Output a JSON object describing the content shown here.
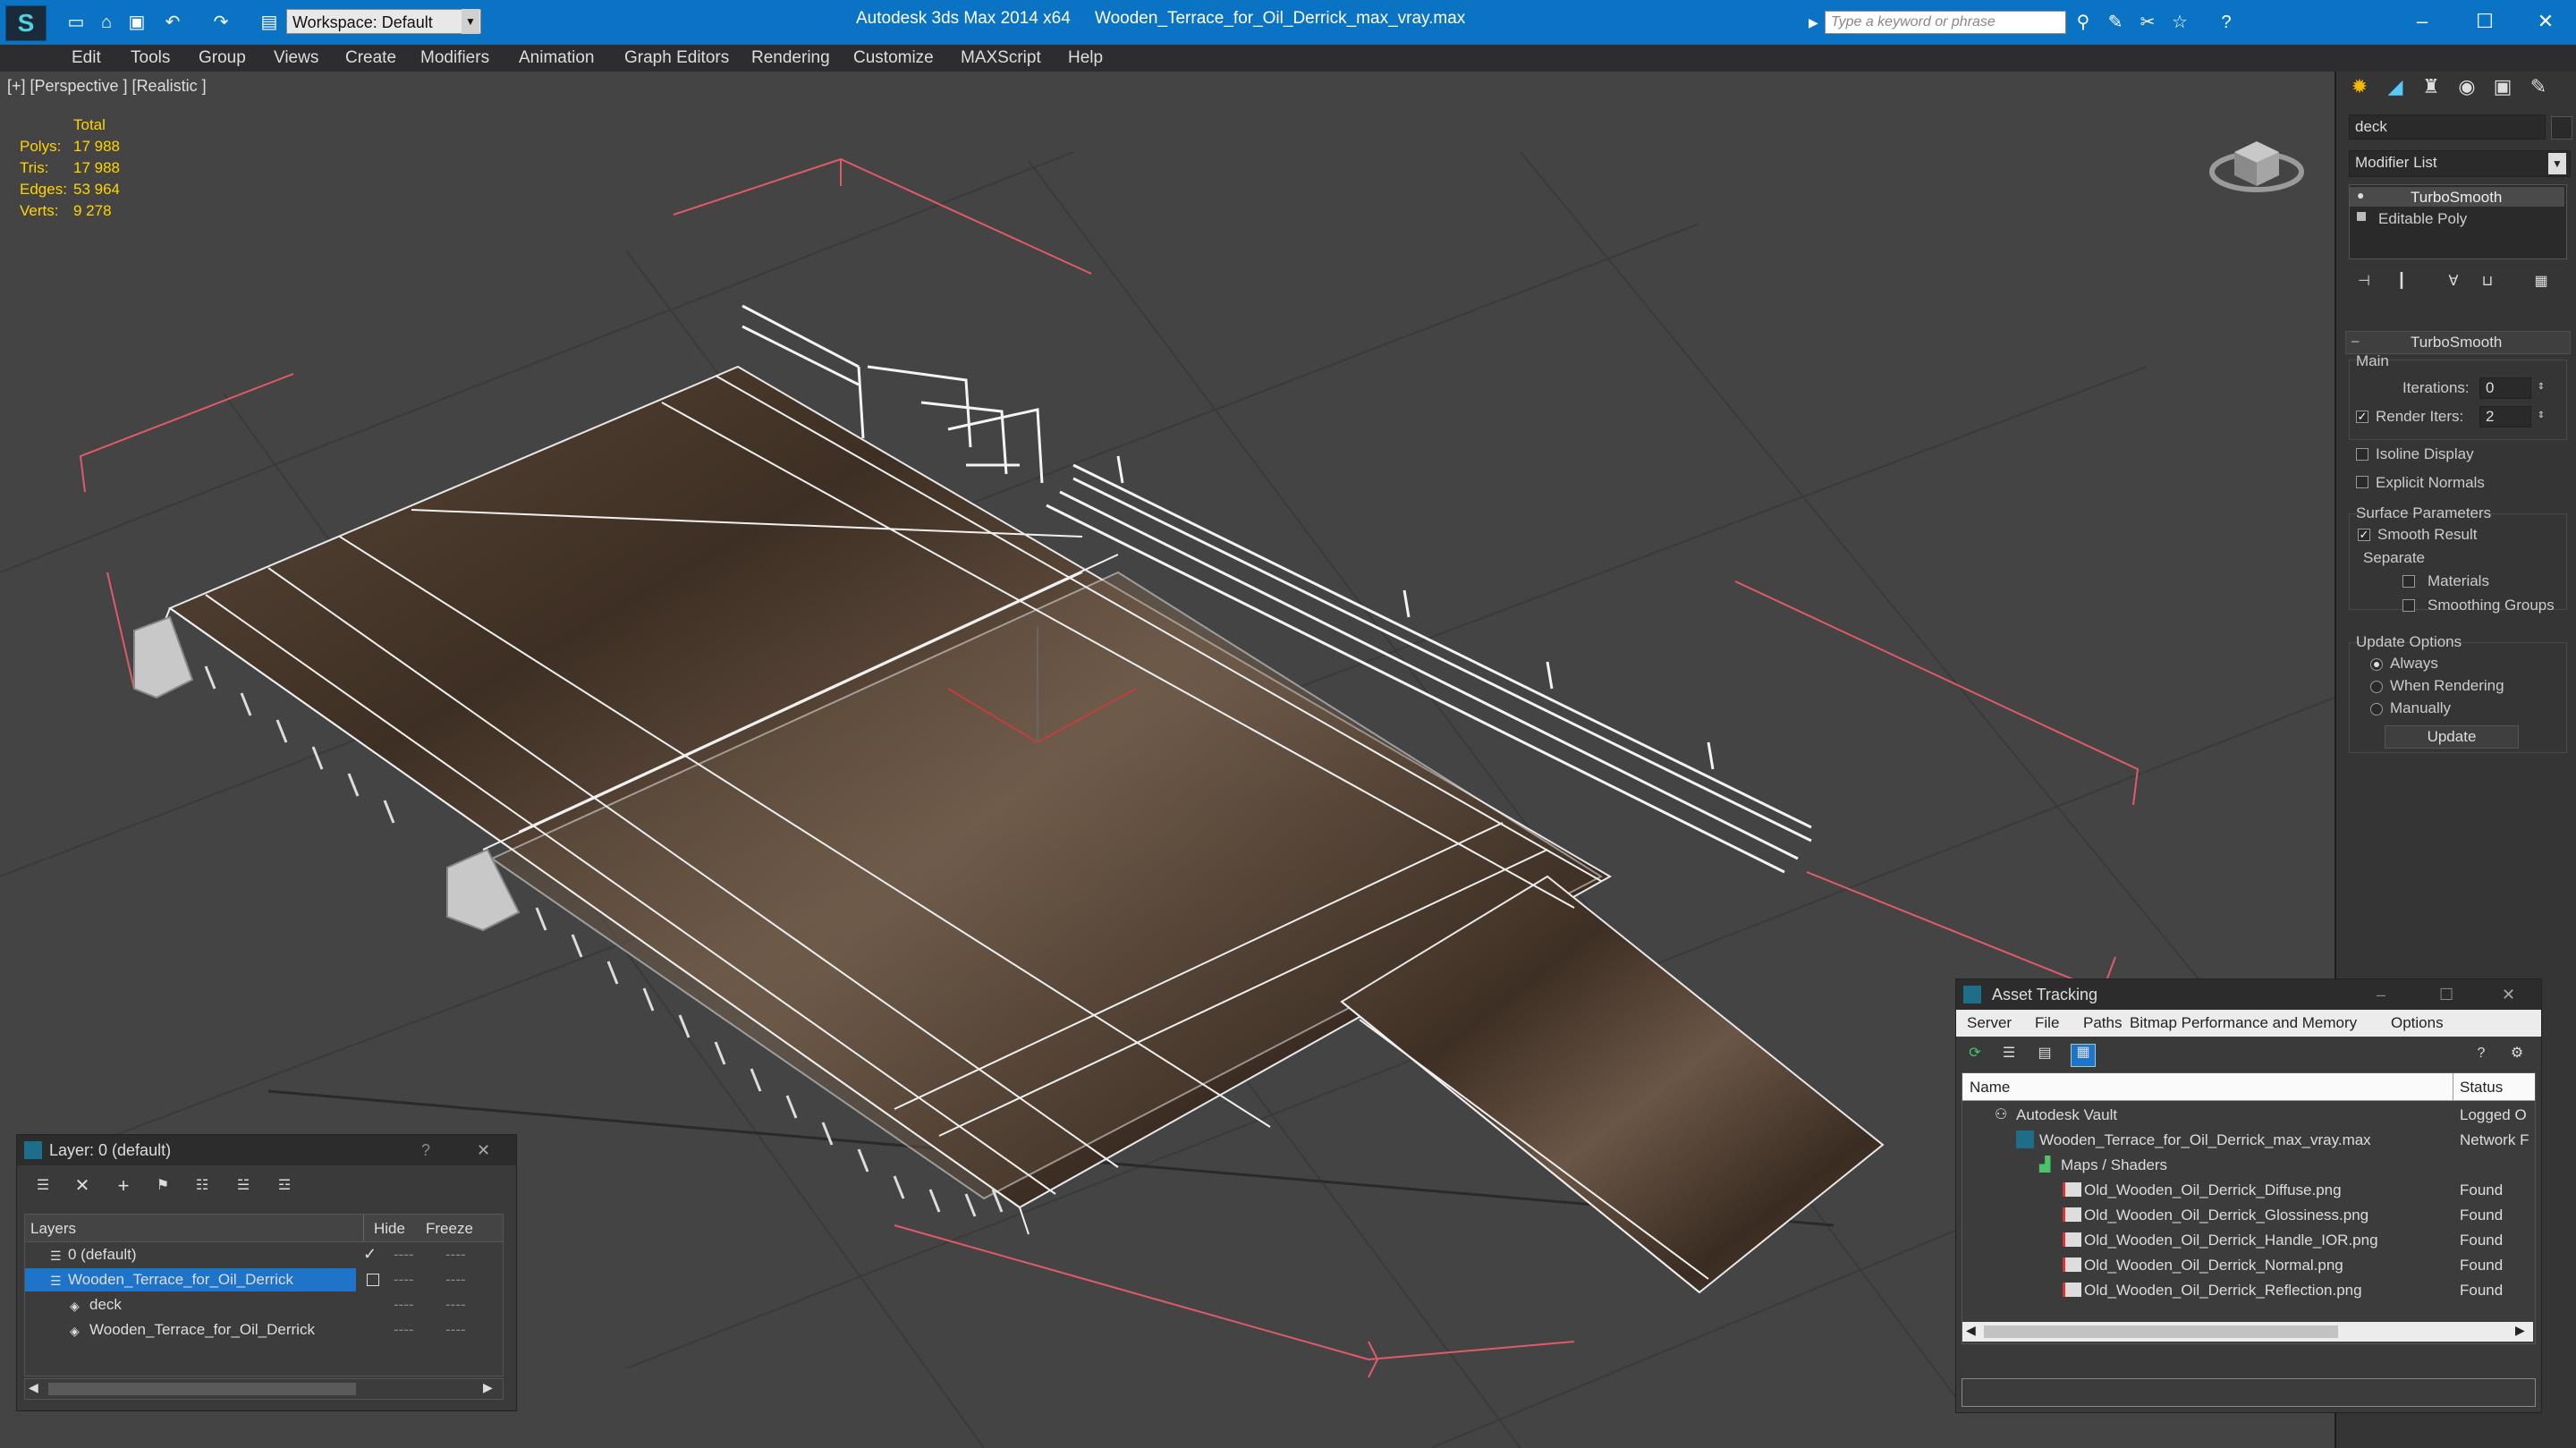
{
  "titlebar": {
    "workspace_label": "Workspace: Default",
    "app_title": "Autodesk 3ds Max  2014 x64",
    "file_title": "Wooden_Terrace_for_Oil_Derrick_max_vray.max",
    "search_placeholder": "Type a keyword or phrase"
  },
  "menu": [
    "Edit",
    "Tools",
    "Group",
    "Views",
    "Create",
    "Modifiers",
    "Animation",
    "Graph Editors",
    "Rendering",
    "Customize",
    "MAXScript",
    "Help"
  ],
  "viewport": {
    "label": "[+] [Perspective ] [Realistic ]",
    "stats": {
      "header": "Total",
      "polys_label": "Polys:",
      "polys": "17 988",
      "tris_label": "Tris:",
      "tris": "17 988",
      "edges_label": "Edges:",
      "edges": "53 964",
      "verts_label": "Verts:",
      "verts": "9 278"
    }
  },
  "command_panel": {
    "object_name": "deck",
    "modifier_list": "Modifier List",
    "stack": [
      "TurboSmooth",
      "Editable Poly"
    ],
    "rollout_title": "TurboSmooth",
    "main_label": "Main",
    "iterations_label": "Iterations:",
    "iterations": "0",
    "render_iters_label": "Render Iters:",
    "render_iters": "2",
    "isoline": "Isoline Display",
    "explicit_normals": "Explicit Normals",
    "surface_params": "Surface Parameters",
    "smooth_result": "Smooth Result",
    "separate": "Separate",
    "materials": "Materials",
    "smoothing_groups": "Smoothing Groups",
    "update_options": "Update Options",
    "always": "Always",
    "when_rendering": "When Rendering",
    "manually": "Manually",
    "update_button": "Update"
  },
  "layer_panel": {
    "title": "Layer: 0 (default)",
    "help": "?",
    "col_layers": "Layers",
    "col_hide": "Hide",
    "col_freeze": "Freeze",
    "rows": [
      {
        "name": "0 (default)",
        "dash": "----"
      },
      {
        "name": "Wooden_Terrace_for_Oil_Derrick",
        "dash": "----"
      },
      {
        "name": "deck",
        "dash": "----"
      },
      {
        "name": "Wooden_Terrace_for_Oil_Derrick",
        "dash": "----"
      }
    ]
  },
  "asset_panel": {
    "title": "Asset Tracking",
    "menu": [
      "Server",
      "File",
      "Paths",
      "Bitmap Performance and Memory",
      "Options"
    ],
    "col_name": "Name",
    "col_status": "Status",
    "rows": [
      {
        "name": "Autodesk Vault",
        "status": "Logged O"
      },
      {
        "name": "Wooden_Terrace_for_Oil_Derrick_max_vray.max",
        "status": "Network F"
      },
      {
        "name": "Maps / Shaders",
        "status": ""
      },
      {
        "name": "Old_Wooden_Oil_Derrick_Diffuse.png",
        "status": "Found"
      },
      {
        "name": "Old_Wooden_Oil_Derrick_Glossiness.png",
        "status": "Found"
      },
      {
        "name": "Old_Wooden_Oil_Derrick_Handle_IOR.png",
        "status": "Found"
      },
      {
        "name": "Old_Wooden_Oil_Derrick_Normal.png",
        "status": "Found"
      },
      {
        "name": "Old_Wooden_Oil_Derrick_Reflection.png",
        "status": "Found"
      }
    ]
  }
}
